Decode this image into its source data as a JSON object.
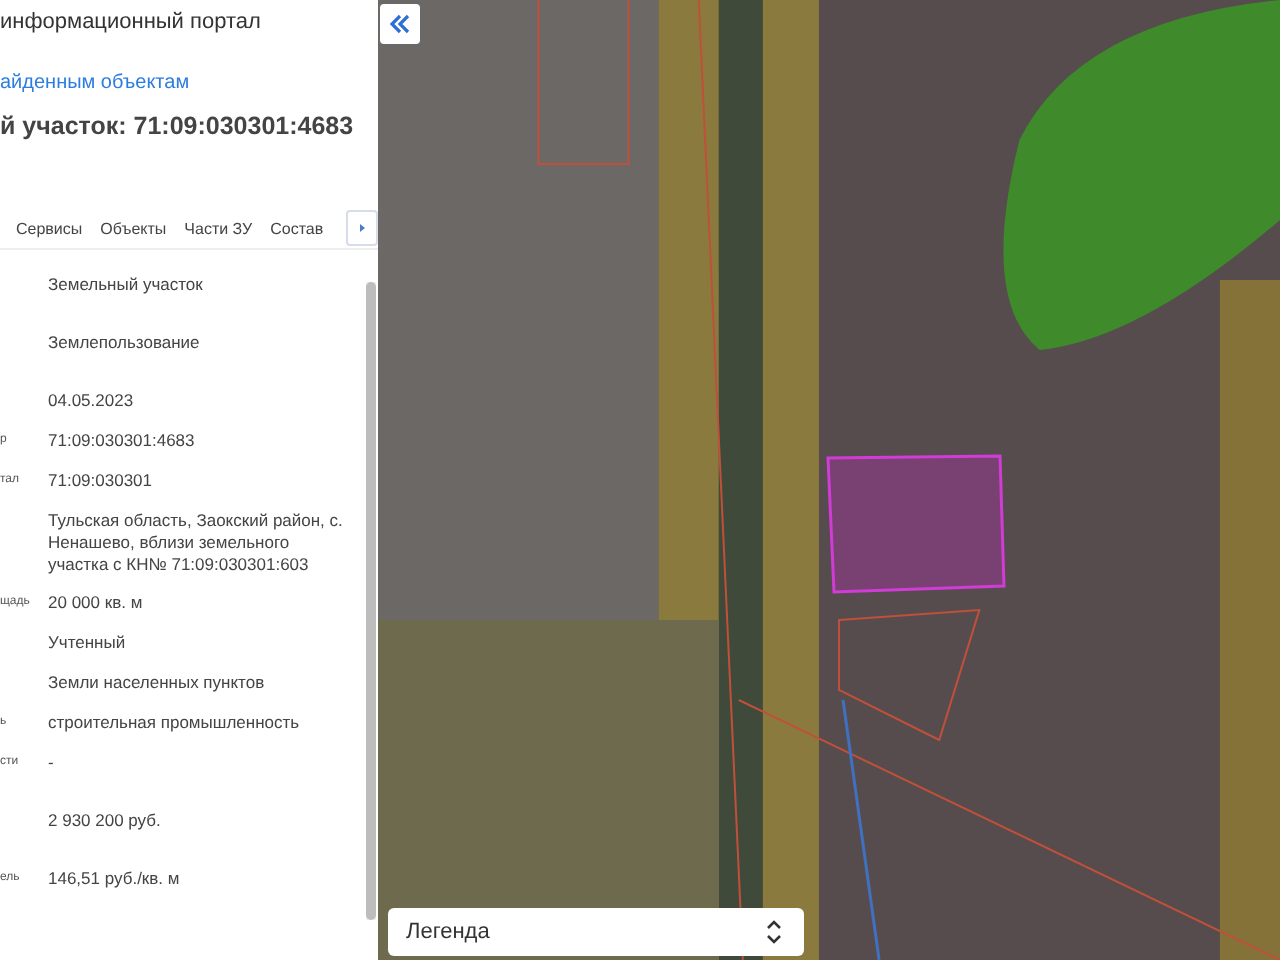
{
  "panel": {
    "portal_title": "информационный портал",
    "back_link": "айденным объектам",
    "parcel_title": "й участок: 71:09:030301:4683"
  },
  "tabs": [
    {
      "label": "Сервисы"
    },
    {
      "label": "Объекты"
    },
    {
      "label": "Части ЗУ"
    },
    {
      "label": "Состав"
    }
  ],
  "properties": [
    {
      "value": "Земельный участок"
    },
    {
      "value": "Землепользование"
    },
    {
      "value": "04.05.2023"
    },
    {
      "label": "р",
      "value": "71:09:030301:4683"
    },
    {
      "label": "тал",
      "value": "71:09:030301"
    },
    {
      "value": "Тульская область, Заокский район, с. Ненашево, вблизи земельного участка с КН№ 71:09:030301:603"
    },
    {
      "label": "щадь",
      "value": "20 000 кв. м"
    },
    {
      "value": "Учтенный"
    },
    {
      "value": "Земли населенных пунктов"
    },
    {
      "label": "ь",
      "value": "строительная промышленность"
    },
    {
      "label": "сти",
      "value": "-"
    },
    {
      "value": "2 930 200 руб."
    },
    {
      "label": "ель",
      "value": "146,51 руб./кв. м"
    }
  ],
  "map": {
    "legend": {
      "label": "Легенда"
    }
  }
}
